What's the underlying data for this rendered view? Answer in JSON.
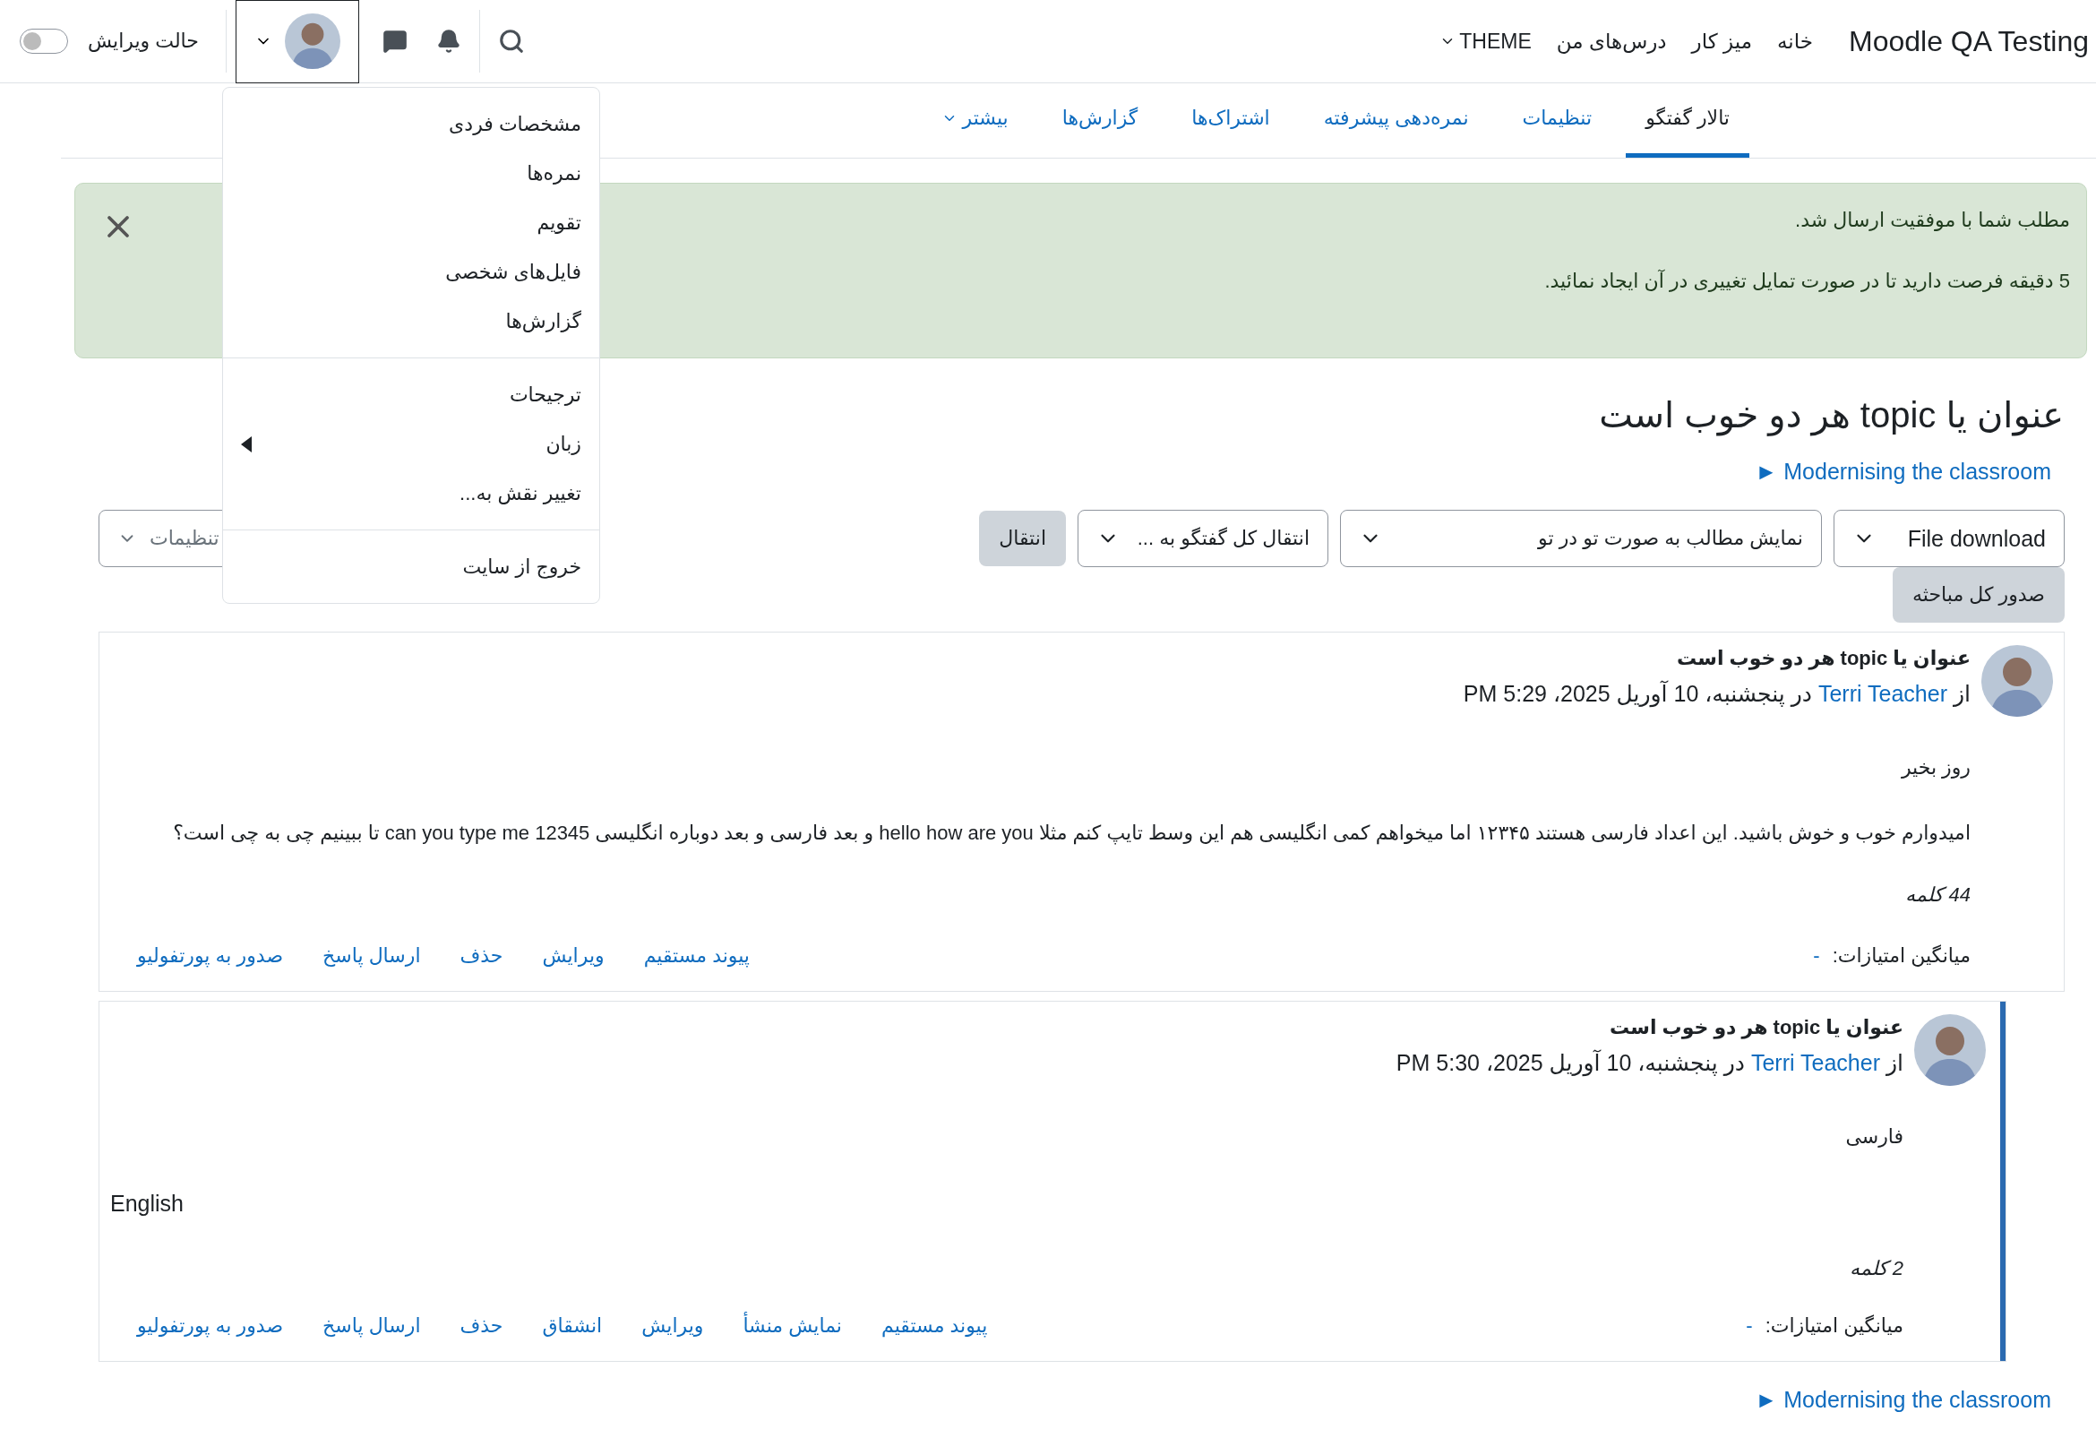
{
  "navbar": {
    "brand": "Moodle QA Testing",
    "links": [
      {
        "label": "خانه",
        "dropdown": false
      },
      {
        "label": "میز کار",
        "dropdown": false
      },
      {
        "label": "درس‌های من",
        "dropdown": false
      },
      {
        "label": "THEME",
        "dropdown": true
      }
    ],
    "edit_mode": {
      "label": "حالت ویرایش",
      "on": false
    },
    "user_menu": {
      "expanded": true,
      "groups": [
        [
          {
            "label": "مشخصات فردی",
            "submenu": false
          },
          {
            "label": "نمره‌ها",
            "submenu": false
          },
          {
            "label": "تقویم",
            "submenu": false
          },
          {
            "label": "فایل‌های شخصی",
            "submenu": false
          },
          {
            "label": "گزارش‌ها",
            "submenu": false
          }
        ],
        [
          {
            "label": "ترجیحات",
            "submenu": false
          },
          {
            "label": "زبان",
            "submenu": true
          },
          {
            "label": "تغییر نقش به...",
            "submenu": false
          }
        ],
        [
          {
            "label": "خروج از سایت",
            "submenu": false
          }
        ]
      ]
    }
  },
  "tabs": [
    {
      "label": "تالار گفتگو",
      "selected": true,
      "dropdown": false
    },
    {
      "label": "تنظیمات",
      "selected": false,
      "dropdown": false
    },
    {
      "label": "نمره‌دهی پیشرفته",
      "selected": false,
      "dropdown": false
    },
    {
      "label": "اشتراک‌ها",
      "selected": false,
      "dropdown": false
    },
    {
      "label": "گزارش‌ها",
      "selected": false,
      "dropdown": false
    },
    {
      "label": "بیشتر",
      "selected": false,
      "dropdown": true
    }
  ],
  "alert": {
    "lines": [
      "مطلب شما با موفقیت ارسال شد.",
      "5 دقیقه فرصت دارید تا در صورت تمایل تغییری در آن ایجاد نمائید."
    ]
  },
  "discussion": {
    "title": "عنوان یا topic هر دو خوب است",
    "course_link": "Modernising the classroom ►",
    "controls": {
      "export_select": "File download",
      "display_select": "نمایش مطالب به صورت تو در تو",
      "move_select": "انتقال کل گفتگو به ...",
      "move_button": "انتقال",
      "settings": "تنظیمات",
      "export_button": "صدور کل مباحثه"
    }
  },
  "posts": [
    {
      "reply": false,
      "title": "عنوان یا topic هر دو خوب است",
      "by": "از",
      "author": "Terri Teacher",
      "date": "در پنجشنبه، 10 آوریل 2025، 5:29 PM",
      "paragraphs": [
        {
          "text": "روز بخیر",
          "ltr": false
        },
        {
          "text": "امیدوارم خوب و خوش باشید. این اعداد فارسی هستند ۱۲۳۴۵ اما میخواهم کمی انگلیسی هم این وسط تایپ کنم مثلا hello how are you و بعد فارسی و بعد دوباره انگلیسی can you type me 12345 تا ببینیم چی به چی است؟",
          "ltr": false
        }
      ],
      "word_count": "44 کلمه",
      "rating_label": "میانگین امتیازات:",
      "rating": "-",
      "actions": [
        "پیوند مستقیم",
        "ویرایش",
        "حذف",
        "ارسال پاسخ",
        "صدور به پورتفولیو"
      ]
    },
    {
      "reply": true,
      "title": "عنوان یا topic هر دو خوب است",
      "by": "از",
      "author": "Terri Teacher",
      "date": "در پنجشنبه، 10 آوریل 2025، 5:30 PM",
      "paragraphs": [
        {
          "text": "فارسی",
          "ltr": false
        },
        {
          "text": "English",
          "ltr": true
        }
      ],
      "word_count": "2 کلمه",
      "rating_label": "میانگین امتیازات:",
      "rating": "-",
      "actions": [
        "پیوند مستقیم",
        "نمایش منشأ",
        "ویرایش",
        "انشقاق",
        "حذف",
        "ارسال پاسخ",
        "صدور به پورتفولیو"
      ]
    }
  ],
  "footer_link": "Modernising the classroom ►"
}
